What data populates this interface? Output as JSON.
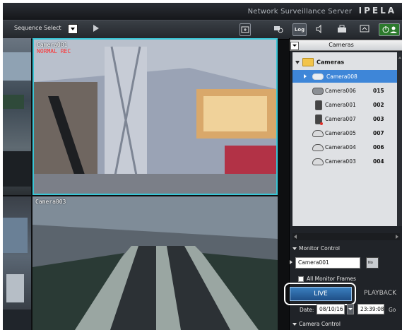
{
  "titlebar": {
    "brand_text": "Network Surveillance Server",
    "logo": "IPELA"
  },
  "toolbar": {
    "sequence_label": "Sequence Select",
    "log_label": "Log",
    "icons": [
      "play-icon",
      "layout-icon",
      "camera-search-icon",
      "log-icon",
      "speaker-icon",
      "toolbox-icon",
      "monitor-settings-icon",
      "power-user-icon"
    ]
  },
  "views": {
    "main": {
      "camera": "Camera001",
      "status": "NORMAL REC"
    },
    "bottom": {
      "camera": "Camera003"
    }
  },
  "panel": {
    "header": "Cameras",
    "tree_root": "Cameras",
    "cameras": [
      {
        "name": "Camera008",
        "code": "",
        "selected": true
      },
      {
        "name": "Camera006",
        "code": "015"
      },
      {
        "name": "Camera001",
        "code": "002"
      },
      {
        "name": "Camera007",
        "code": "003"
      },
      {
        "name": "Camera005",
        "code": "007"
      },
      {
        "name": "Camera004",
        "code": "006"
      },
      {
        "name": "Camera003",
        "code": "004"
      }
    ],
    "monitor_control": "Monitor Control",
    "monitor_input": "Camera001",
    "monitor_icon_text": "No",
    "all_monitor_frames": "All Monitor Frames",
    "live_label": "LIVE",
    "playback_label": "PLAYBACK",
    "date_label": "Date:",
    "date_value": "08/10/16",
    "time_value": "23:39:08",
    "go_label": "Go",
    "camera_control": "Camera Control"
  }
}
